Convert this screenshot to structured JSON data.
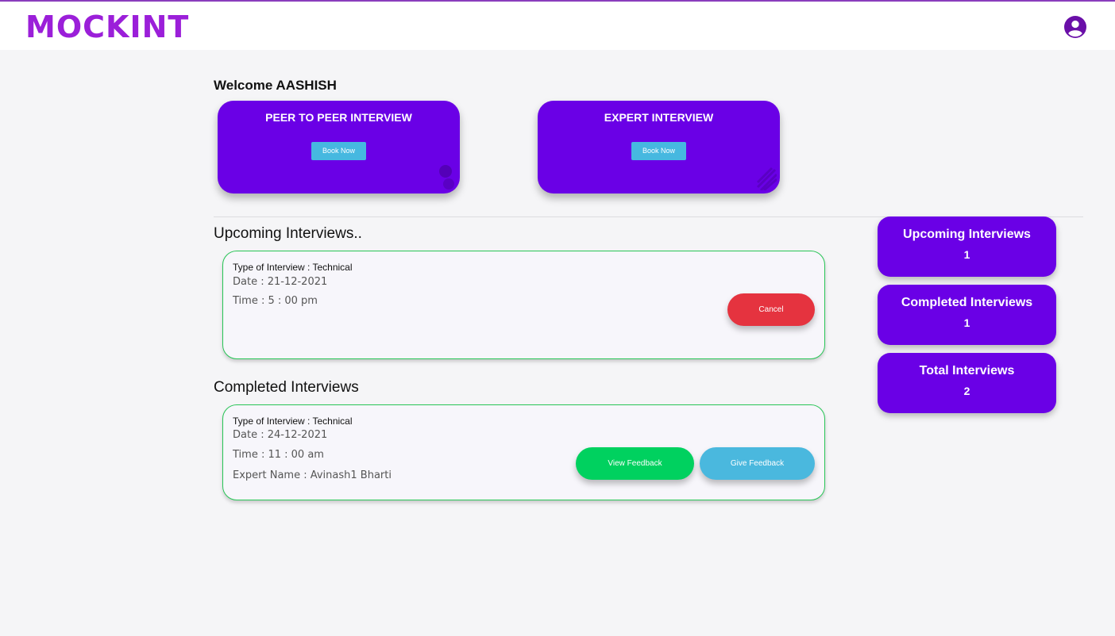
{
  "header": {
    "logo": "MOCKINT",
    "profile_icon": "account-circle-icon"
  },
  "colors": {
    "brand": "#6a00e6",
    "logo": "#9b1fd9",
    "book_button": "#46b8e0",
    "cancel": "#e5333f",
    "view_feedback": "#00d15f",
    "give_feedback": "#4ab8de",
    "card_border": "#29c657"
  },
  "welcome": "Welcome AASHISH",
  "booking": [
    {
      "title": "PEER TO PEER INTERVIEW",
      "button": "Book Now"
    },
    {
      "title": "EXPERT INTERVIEW",
      "button": "Book Now"
    }
  ],
  "upcoming": {
    "heading": "Upcoming Interviews..",
    "items": [
      {
        "type": "Type of Interview : Technical",
        "date": "Date : 21-12-2021",
        "time": "Time : 5 : 00 pm",
        "cancel": "Cancel"
      }
    ]
  },
  "completed": {
    "heading": "Completed Interviews",
    "items": [
      {
        "type": "Type of Interview : Technical",
        "date": "Date : 24-12-2021",
        "time": "Time : 11 : 00 am",
        "expert": "Expert Name : Avinash1 Bharti",
        "view_feedback": "View Feedback",
        "give_feedback": "Give Feedback"
      }
    ]
  },
  "stats": [
    {
      "label": "Upcoming Interviews",
      "value": "1"
    },
    {
      "label": "Completed Interviews",
      "value": "1"
    },
    {
      "label": "Total Interviews",
      "value": "2"
    }
  ]
}
